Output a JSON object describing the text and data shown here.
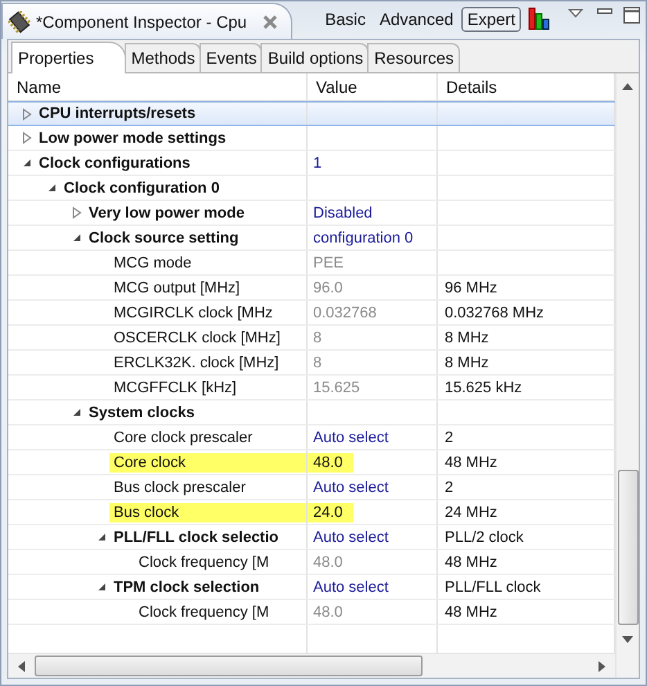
{
  "editor_tab": {
    "title": "*Component Inspector - Cpu"
  },
  "modes": [
    {
      "label": "Basic",
      "selected": false
    },
    {
      "label": "Advanced",
      "selected": false
    },
    {
      "label": "Expert",
      "selected": true
    }
  ],
  "tabs": [
    {
      "label": "Properties",
      "selected": true
    },
    {
      "label": "Methods",
      "selected": false
    },
    {
      "label": "Events",
      "selected": false
    },
    {
      "label": "Build options",
      "selected": false
    },
    {
      "label": "Resources",
      "selected": false
    }
  ],
  "columns": [
    "Name",
    "Value",
    "Details"
  ],
  "tree": [
    {
      "kind": "group",
      "name": "CPU interrupts/resets",
      "expanded": false,
      "selected": true
    },
    {
      "kind": "group",
      "name": "Low power mode settings",
      "expanded": false,
      "selected": false
    },
    {
      "kind": "group",
      "name": "Clock configurations",
      "value": "1",
      "editable": true,
      "read_only": false,
      "expanded": true,
      "selected": false,
      "children": [
        {
          "kind": "group",
          "name": "Clock configuration 0",
          "expanded": true,
          "selected": false,
          "children": [
            {
              "kind": "group",
              "name": "Very low power mode",
              "value": "Disabled",
              "editable": true,
              "read_only": false,
              "expanded": false,
              "selected": false
            },
            {
              "kind": "group",
              "name": "Clock source setting",
              "value": "configuration 0",
              "editable": true,
              "read_only": false,
              "expanded": true,
              "selected": false,
              "children": [
                {
                  "kind": "property",
                  "name": "MCG mode",
                  "value": "PEE",
                  "editable": false,
                  "read_only": true,
                  "selected": false
                },
                {
                  "kind": "property",
                  "name": "MCG output [MHz]",
                  "value": "96.0",
                  "editable": false,
                  "read_only": true,
                  "details": "96 MHz",
                  "selected": false
                },
                {
                  "kind": "property",
                  "name": "MCGIRCLK clock [MHz",
                  "value": "0.032768",
                  "editable": false,
                  "read_only": true,
                  "details": "0.032768 MHz",
                  "selected": false
                },
                {
                  "kind": "property",
                  "name": "OSCERCLK clock [MHz]",
                  "value": "8",
                  "editable": false,
                  "read_only": true,
                  "details": "8 MHz",
                  "selected": false
                },
                {
                  "kind": "property",
                  "name": "ERCLK32K. clock [MHz]",
                  "value": "8",
                  "editable": false,
                  "read_only": true,
                  "details": "8 MHz",
                  "selected": false
                },
                {
                  "kind": "property",
                  "name": "MCGFFCLK [kHz]",
                  "value": "15.625",
                  "editable": false,
                  "read_only": true,
                  "details": "15.625 kHz",
                  "selected": false
                }
              ]
            },
            {
              "kind": "group",
              "name": "System clocks",
              "expanded": true,
              "selected": false,
              "children": [
                {
                  "kind": "property",
                  "name": "Core clock prescaler",
                  "value": "Auto select",
                  "editable": true,
                  "read_only": false,
                  "details": "2",
                  "selected": false
                },
                {
                  "kind": "property",
                  "name": "Core clock",
                  "value": "48.0",
                  "editable": false,
                  "read_only": false,
                  "details": "48 MHz",
                  "highlighted": true,
                  "selected": false
                },
                {
                  "kind": "property",
                  "name": "Bus clock prescaler",
                  "value": "Auto select",
                  "editable": true,
                  "read_only": false,
                  "details": "2",
                  "selected": false
                },
                {
                  "kind": "property",
                  "name": "Bus clock",
                  "value": "24.0",
                  "editable": false,
                  "read_only": false,
                  "details": "24 MHz",
                  "highlighted": true,
                  "selected": false
                },
                {
                  "kind": "group",
                  "name": "PLL/FLL clock selectio",
                  "value": "Auto select",
                  "editable": true,
                  "read_only": false,
                  "details": "PLL/2 clock",
                  "expanded": true,
                  "selected": false,
                  "children": [
                    {
                      "kind": "property",
                      "name": "Clock frequency [M",
                      "value": "48.0",
                      "editable": false,
                      "read_only": true,
                      "details": "48 MHz",
                      "selected": false
                    }
                  ]
                },
                {
                  "kind": "group",
                  "name": "TPM clock selection",
                  "value": "Auto select",
                  "editable": true,
                  "read_only": false,
                  "details": "PLL/FLL clock",
                  "expanded": true,
                  "selected": false,
                  "children": [
                    {
                      "kind": "property",
                      "name": "Clock frequency [M",
                      "value": "48.0",
                      "editable": false,
                      "read_only": true,
                      "details": "48 MHz",
                      "selected": false
                    }
                  ]
                }
              ]
            }
          ]
        }
      ]
    }
  ]
}
